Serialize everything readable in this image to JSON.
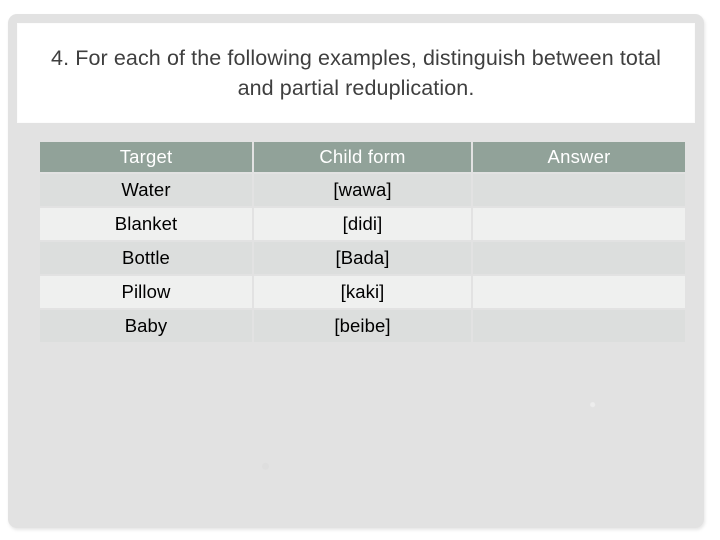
{
  "slide": {
    "title": "4. For each of the following examples, distinguish between total and partial reduplication.",
    "background_color": "#e2e2e2",
    "title_card_color": "#ffffff",
    "title_text_color": "#3f3f3f"
  },
  "table": {
    "header_background": "#91a299",
    "header_text_color": "#ffffff",
    "row_color_dark": "#dcdedd",
    "row_color_light": "#eff0ef",
    "columns": [
      {
        "key": "target",
        "label": "Target"
      },
      {
        "key": "child_form",
        "label": "Child form"
      },
      {
        "key": "answer",
        "label": "Answer"
      }
    ],
    "rows": [
      {
        "target": "Water",
        "child_form": "[wawa]",
        "answer": ""
      },
      {
        "target": "Blanket",
        "child_form": "[didi]",
        "answer": ""
      },
      {
        "target": "Bottle",
        "child_form": "[Bada]",
        "answer": ""
      },
      {
        "target": "Pillow",
        "child_form": "[kaki]",
        "answer": ""
      },
      {
        "target": "Baby",
        "child_form": "[beibe]",
        "answer": ""
      }
    ]
  }
}
